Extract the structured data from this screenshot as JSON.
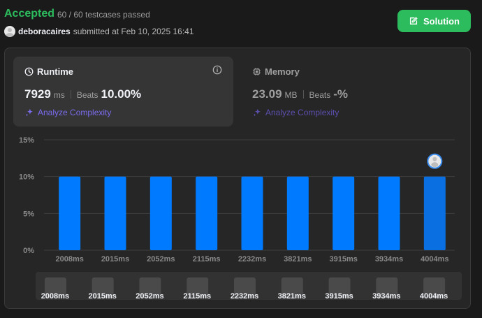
{
  "header": {
    "status": "Accepted",
    "testcases": "60 / 60 testcases passed",
    "username": "deboracaires",
    "submitted": "submitted at Feb 10, 2025 16:41",
    "solution_label": "Solution"
  },
  "runtime": {
    "title": "Runtime",
    "value": "7929",
    "unit": "ms",
    "beats_label": "Beats",
    "beats_value": "10.00%",
    "analyze_label": "Analyze Complexity"
  },
  "memory": {
    "title": "Memory",
    "value": "23.09",
    "unit": "MB",
    "beats_label": "Beats",
    "beats_value": "-%",
    "analyze_label": "Analyze Complexity"
  },
  "colors": {
    "accepted": "#2cbb5d",
    "bar": "#007aff",
    "bar_selected": "#0a6fe0",
    "analyze": "#7b6cf0"
  },
  "chart_data": {
    "type": "bar",
    "categories": [
      "2008ms",
      "2015ms",
      "2052ms",
      "2115ms",
      "2232ms",
      "3821ms",
      "3915ms",
      "3934ms",
      "4004ms"
    ],
    "values": [
      10,
      10,
      10,
      10,
      10,
      10,
      10,
      10,
      10
    ],
    "y_ticks": [
      "0%",
      "5%",
      "10%",
      "15%"
    ],
    "ylim": [
      0,
      15
    ],
    "grid": true,
    "highlighted_category": "4004ms",
    "xlabel": "",
    "ylabel": ""
  }
}
